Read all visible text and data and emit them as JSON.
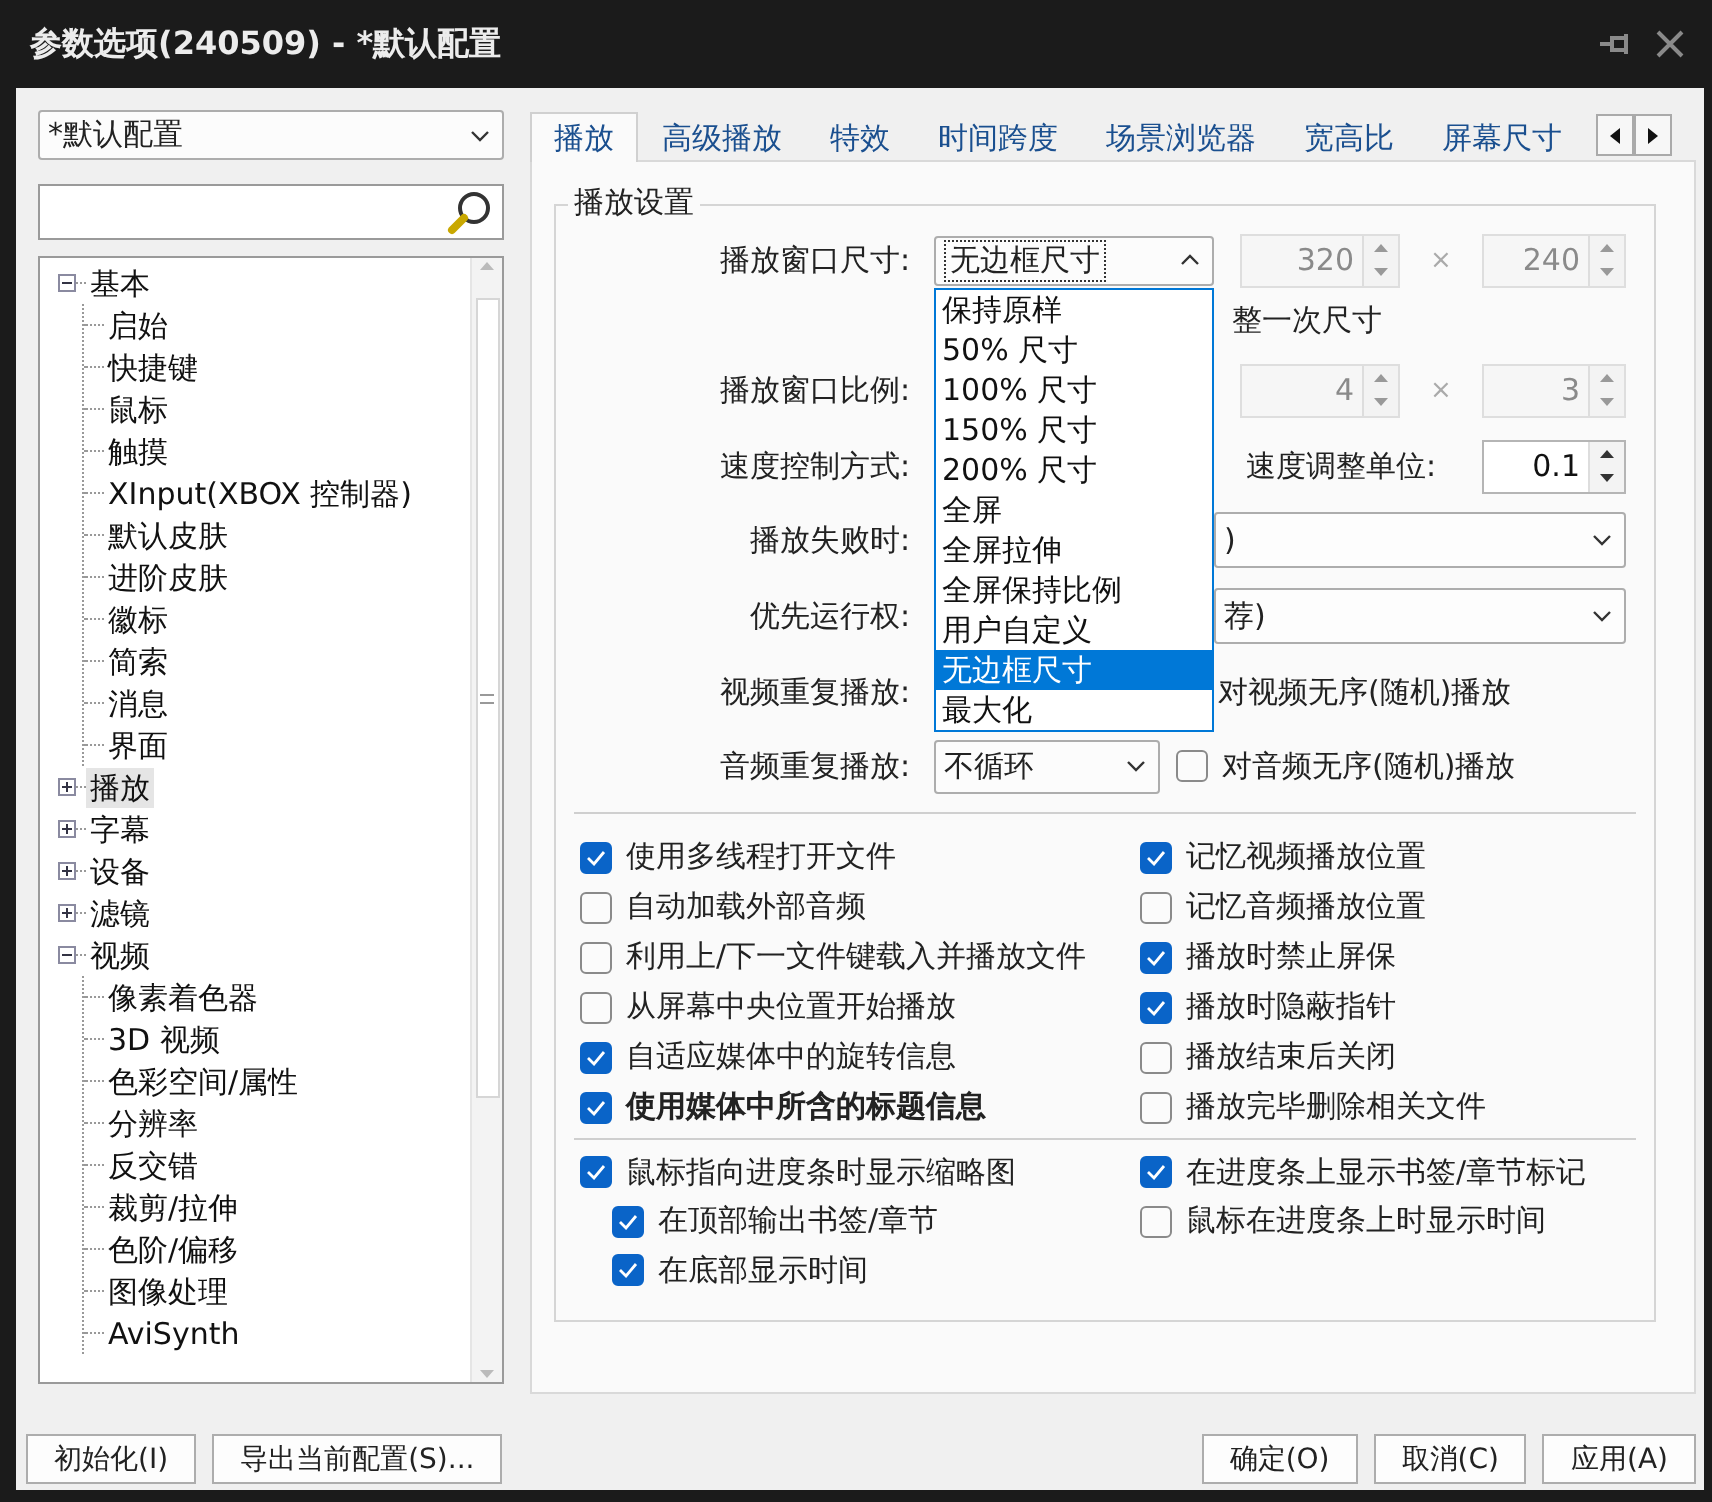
{
  "window": {
    "title": "参数选项(240509) - *默认配置"
  },
  "profile_select": {
    "value": "*默认配置"
  },
  "tree": [
    {
      "label": "基本",
      "expanded": true,
      "selected": false,
      "children": [
        {
          "label": "启始",
          "selected": false
        },
        {
          "label": "快捷键",
          "selected": false
        },
        {
          "label": "鼠标",
          "selected": false
        },
        {
          "label": "触摸",
          "selected": false
        },
        {
          "label": "XInput(XBOX 控制器)",
          "selected": false
        },
        {
          "label": "默认皮肤",
          "selected": false
        },
        {
          "label": "进阶皮肤",
          "selected": false
        },
        {
          "label": "徽标",
          "selected": false
        },
        {
          "label": "简索",
          "selected": false
        },
        {
          "label": "消息",
          "selected": false
        },
        {
          "label": "界面",
          "selected": false
        }
      ]
    },
    {
      "label": "播放",
      "expanded": false,
      "selected": true
    },
    {
      "label": "字幕",
      "expanded": false,
      "selected": false
    },
    {
      "label": "设备",
      "expanded": false,
      "selected": false
    },
    {
      "label": "滤镜",
      "expanded": false,
      "selected": false
    },
    {
      "label": "视频",
      "expanded": true,
      "selected": false,
      "children": [
        {
          "label": "像素着色器",
          "selected": false
        },
        {
          "label": "3D 视频",
          "selected": false
        },
        {
          "label": "色彩空间/属性",
          "selected": false
        },
        {
          "label": "分辨率",
          "selected": false
        },
        {
          "label": "反交错",
          "selected": false
        },
        {
          "label": "裁剪/拉伸",
          "selected": false
        },
        {
          "label": "色阶/偏移",
          "selected": false
        },
        {
          "label": "图像处理",
          "selected": false
        },
        {
          "label": "AviSynth",
          "selected": false
        }
      ]
    }
  ],
  "tabs": [
    {
      "label": "播放",
      "selected": true
    },
    {
      "label": "高级播放",
      "selected": false
    },
    {
      "label": "特效",
      "selected": false
    },
    {
      "label": "时间跨度",
      "selected": false
    },
    {
      "label": "场景浏览器",
      "selected": false
    },
    {
      "label": "宽高比",
      "selected": false
    },
    {
      "label": "屏幕尺寸",
      "selected": false
    }
  ],
  "playback_settings": {
    "title": "播放设置",
    "rows": [
      {
        "kind": "size",
        "label": "播放窗口尺寸:",
        "select": {
          "value": "无边框尺寸",
          "options": [
            {
              "label": "保持原样",
              "selected": false
            },
            {
              "label": "50% 尺寸",
              "selected": false
            },
            {
              "label": "100% 尺寸",
              "selected": false
            },
            {
              "label": "150% 尺寸",
              "selected": false
            },
            {
              "label": "200% 尺寸",
              "selected": false
            },
            {
              "label": "全屏",
              "selected": false
            },
            {
              "label": "全屏拉伸",
              "selected": false
            },
            {
              "label": "全屏保持比例",
              "selected": false
            },
            {
              "label": "用户自定义",
              "selected": false
            },
            {
              "label": "无边框尺寸",
              "selected": true
            },
            {
              "label": "最大化",
              "selected": false
            }
          ]
        },
        "a": {
          "value": "320",
          "disabled": true
        },
        "times": "×",
        "b": {
          "value": "240",
          "disabled": true
        }
      },
      {
        "kind": "text",
        "text": "整一次尺寸"
      },
      {
        "kind": "size",
        "label": "播放窗口比例:",
        "a": {
          "value": "4",
          "disabled": true
        },
        "times": "×",
        "b": {
          "value": "3",
          "disabled": true
        }
      },
      {
        "kind": "speed",
        "label": "速度控制方式:",
        "unit_label": "速度调整单位:",
        "unit": {
          "value": "0.1",
          "disabled": false
        }
      },
      {
        "kind": "select",
        "label": "播放失败时:",
        "value": ")"
      },
      {
        "kind": "select",
        "label": "优先运行权:",
        "value": "荐)"
      },
      {
        "kind": "text",
        "label": "视频重复播放:",
        "text": "对视频无序(随机)播放"
      },
      {
        "kind": "loop",
        "label": "音频重复播放:",
        "value": "不循环",
        "checkbox": {
          "label": "对音频无序(随机)播放",
          "checked": false
        }
      }
    ],
    "checkboxes": [
      {
        "label": "使用多线程打开文件",
        "checked": true,
        "bold": false
      },
      {
        "label": "记忆视频播放位置",
        "checked": true,
        "bold": false
      },
      {
        "label": "自动加载外部音频",
        "checked": false,
        "bold": false
      },
      {
        "label": "记忆音频播放位置",
        "checked": false,
        "bold": false
      },
      {
        "label": "利用上/下一文件键载入并播放文件",
        "checked": false,
        "bold": false
      },
      {
        "label": "播放时禁止屏保",
        "checked": true,
        "bold": false
      },
      {
        "label": "从屏幕中央位置开始播放",
        "checked": false,
        "bold": false
      },
      {
        "label": "播放时隐蔽指针",
        "checked": true,
        "bold": false
      },
      {
        "label": "自适应媒体中的旋转信息",
        "checked": true,
        "bold": false
      },
      {
        "label": "播放结束后关闭",
        "checked": false,
        "bold": false
      },
      {
        "label": "使用媒体中所含的标题信息",
        "checked": true,
        "bold": true
      },
      {
        "label": "播放完毕删除相关文件",
        "checked": false,
        "bold": false
      }
    ],
    "seek_bar_left": [
      {
        "label": "鼠标指向进度条时显示缩略图",
        "checked": true,
        "children": [
          {
            "label": "在顶部输出书签/章节",
            "checked": true
          },
          {
            "label": "在底部显示时间",
            "checked": true
          }
        ]
      }
    ],
    "seek_bar_right": [
      {
        "label": "在进度条上显示书签/章节标记",
        "checked": true
      },
      {
        "label": "鼠标在进度条上时显示时间",
        "checked": false
      }
    ]
  },
  "left_buttons": [
    "初始化(I)",
    "导出当前配置(S)..."
  ],
  "right_buttons": [
    "确定(O)",
    "取消(C)",
    "应用(A)"
  ]
}
